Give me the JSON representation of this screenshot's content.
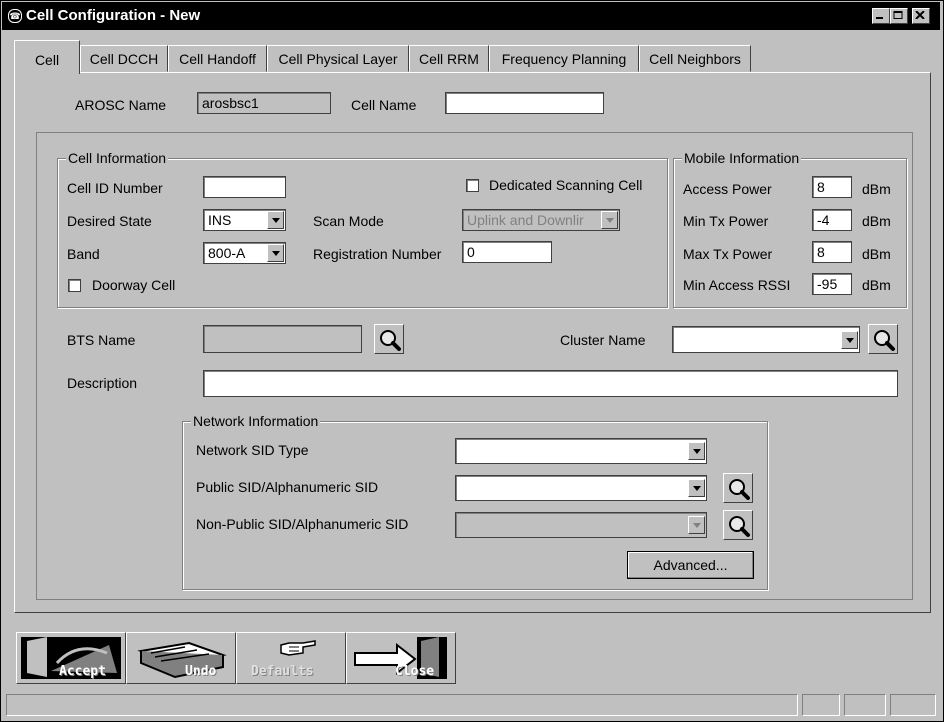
{
  "window": {
    "title": "Cell Configuration - New"
  },
  "tabs": [
    "Cell",
    "Cell DCCH",
    "Cell Handoff",
    "Cell Physical Layer",
    "Cell RRM",
    "Frequency Planning",
    "Cell Neighbors"
  ],
  "top": {
    "arosc_label": "AROSC Name",
    "arosc_value": "arosbsc1",
    "cell_name_label": "Cell Name",
    "cell_name_value": ""
  },
  "cell_info": {
    "group_label": "Cell Information",
    "cell_id_label": "Cell ID Number",
    "cell_id_value": "",
    "desired_state_label": "Desired State",
    "desired_state_value": "INS",
    "band_label": "Band",
    "band_value": "800-A",
    "doorway_label": "Doorway Cell",
    "dedicated_label": "Dedicated Scanning Cell",
    "scan_mode_label": "Scan Mode",
    "scan_mode_value": "Uplink and Downlir",
    "reg_label": "Registration Number",
    "reg_value": "0"
  },
  "mobile_info": {
    "group_label": "Mobile Information",
    "rows": [
      {
        "label": "Access Power",
        "value": "8",
        "unit": "dBm"
      },
      {
        "label": "Min Tx Power",
        "value": "-4",
        "unit": "dBm"
      },
      {
        "label": "Max Tx Power",
        "value": "8",
        "unit": "dBm"
      },
      {
        "label": "Min Access RSSI",
        "value": "-95",
        "unit": "dBm"
      }
    ]
  },
  "bts": {
    "label": "BTS Name",
    "value": ""
  },
  "cluster": {
    "label": "Cluster Name",
    "value": ""
  },
  "description": {
    "label": "Description",
    "value": ""
  },
  "network": {
    "group_label": "Network Information",
    "sid_type_label": "Network SID Type",
    "public_label": "Public SID/Alphanumeric SID",
    "nonpublic_label": "Non-Public SID/Alphanumeric SID",
    "advanced_label": "Advanced..."
  },
  "toolbar": {
    "accept": "Accept",
    "undo": "Undo",
    "defaults": "Defaults",
    "close": "Close"
  },
  "icons": {
    "search": "magnifier-icon",
    "accept": "door-open-icon",
    "undo": "keyboard-icon",
    "defaults": "pointing-hand-icon",
    "close": "door-arrow-icon"
  }
}
